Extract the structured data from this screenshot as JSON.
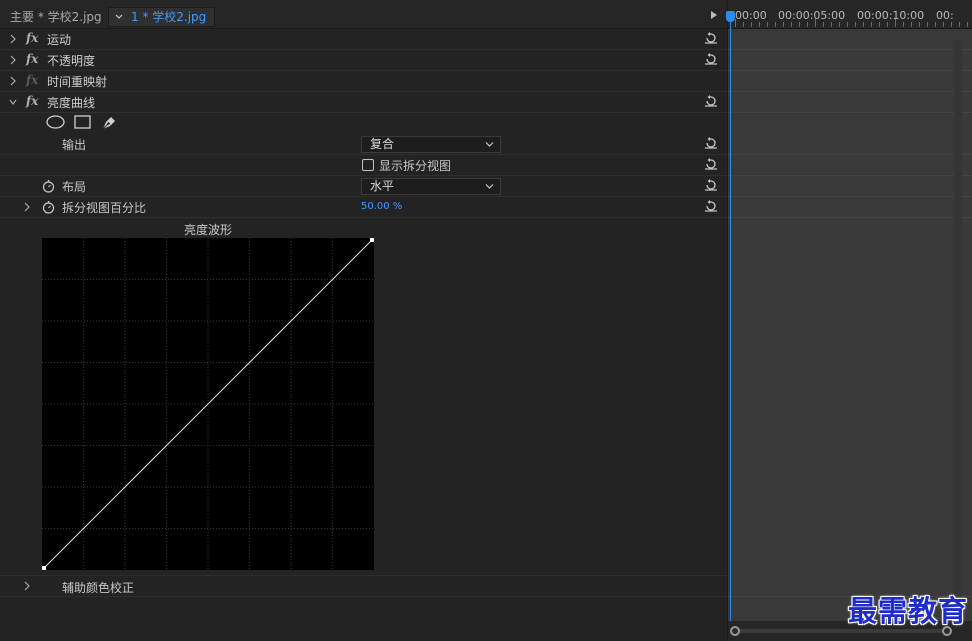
{
  "header": {
    "source_tab": "主要 * 学校2.jpg",
    "clip_tab": "1 * 学校2.jpg"
  },
  "effects": [
    {
      "name": "运动",
      "expanded": false,
      "fx_dim": false
    },
    {
      "name": "不透明度",
      "expanded": false,
      "fx_dim": false
    },
    {
      "name": "时间重映射",
      "expanded": false,
      "fx_dim": true
    },
    {
      "name": "亮度曲线",
      "expanded": true,
      "fx_dim": false
    }
  ],
  "luma_curve": {
    "output_label": "输出",
    "output_value": "复合",
    "split_view_label": "显示拆分视图",
    "split_view_checked": false,
    "layout_label": "布局",
    "layout_value": "水平",
    "split_percent_label": "拆分视图百分比",
    "split_percent_value": "50.00 %",
    "waveform_title": "亮度波形",
    "secondary_label": "辅助颜色校正"
  },
  "timeline": {
    "timecodes": [
      "00:00",
      "00:00:05:00",
      "00:00:10:00",
      "00:"
    ]
  },
  "watermark": "最需教育",
  "colors": {
    "accent_blue": "#3e9bff",
    "playhead": "#2d8ceb",
    "panel_bg": "#232323",
    "timeline_bg": "#3a3a3a"
  },
  "icons": {
    "fx": "fx",
    "reset": "reset-icon",
    "stopwatch": "stopwatch-icon",
    "ellipse": "ellipse-mask-icon",
    "rect": "rectangle-mask-icon",
    "pen": "pen-mask-icon"
  }
}
